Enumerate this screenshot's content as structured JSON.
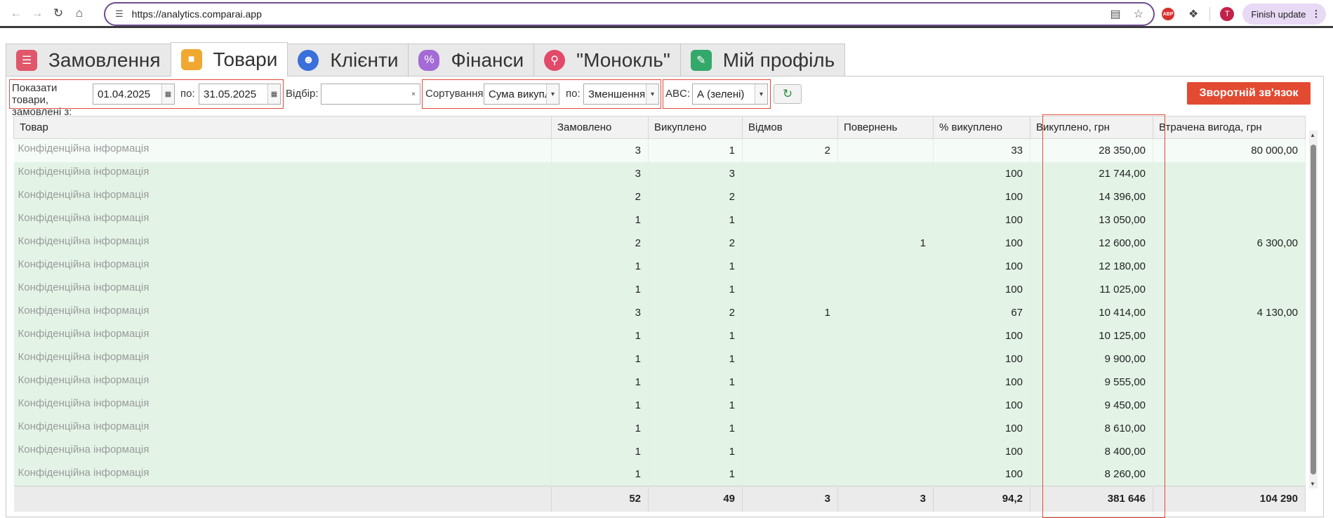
{
  "browser": {
    "url": "https://analytics.comparai.app",
    "finish_update": "Finish update",
    "avatar_letter": "T",
    "abp": "ABP"
  },
  "tabs": [
    {
      "label": "Замовлення",
      "icon": "orders-icon",
      "color": "#e0566a"
    },
    {
      "label": "Товари",
      "icon": "box-icon",
      "color": "#f0a830"
    },
    {
      "label": "Клієнти",
      "icon": "clients-icon",
      "color": "#3b6fd9"
    },
    {
      "label": "Фінанси",
      "icon": "money-bag-icon",
      "color": "#a46ad6"
    },
    {
      "label": "\"Монокль\"",
      "icon": "magnifier-icon",
      "color": "#e24a6a"
    },
    {
      "label": "Мій профіль",
      "icon": "profile-icon",
      "color": "#34a86a"
    }
  ],
  "toolbar": {
    "show_label": "Показати товари, замовлені з:",
    "date_from": "01.04.2025",
    "to_label": "по:",
    "date_to": "31.05.2025",
    "filter_label": "Відбір:",
    "filter_value": "",
    "sort_label": "Сортування:",
    "sort_value": "Сума викупле",
    "sort_dir_label": "по:",
    "sort_dir_value": "Зменшенням",
    "abc_label": "ABC:",
    "abc_value": "А (зелені)",
    "feedback_label": "Зворотній зв'язок"
  },
  "table": {
    "columns": [
      "Товар",
      "Замовлено",
      "Викуплено",
      "Відмов",
      "Повернень",
      "% викуплено",
      "Викуплено, грн",
      "Втрачена вигода, грн"
    ],
    "rows": [
      [
        "Конфіденційна інформація",
        "3",
        "1",
        "2",
        "",
        "33",
        "28 350,00",
        "80 000,00"
      ],
      [
        "Конфіденційна інформація",
        "3",
        "3",
        "",
        "",
        "100",
        "21 744,00",
        ""
      ],
      [
        "Конфіденційна інформація",
        "2",
        "2",
        "",
        "",
        "100",
        "14 396,00",
        ""
      ],
      [
        "Конфіденційна інформація",
        "1",
        "1",
        "",
        "",
        "100",
        "13 050,00",
        ""
      ],
      [
        "Конфіденційна інформація",
        "2",
        "2",
        "",
        "1",
        "100",
        "12 600,00",
        "6 300,00"
      ],
      [
        "Конфіденційна інформація",
        "1",
        "1",
        "",
        "",
        "100",
        "12 180,00",
        ""
      ],
      [
        "Конфіденційна інформація",
        "1",
        "1",
        "",
        "",
        "100",
        "11 025,00",
        ""
      ],
      [
        "Конфіденційна інформація",
        "3",
        "2",
        "1",
        "",
        "67",
        "10 414,00",
        "4 130,00"
      ],
      [
        "Конфіденційна інформація",
        "1",
        "1",
        "",
        "",
        "100",
        "10 125,00",
        ""
      ],
      [
        "Конфіденційна інформація",
        "1",
        "1",
        "",
        "",
        "100",
        "9 900,00",
        ""
      ],
      [
        "Конфіденційна інформація",
        "1",
        "1",
        "",
        "",
        "100",
        "9 555,00",
        ""
      ],
      [
        "Конфіденційна інформація",
        "1",
        "1",
        "",
        "",
        "100",
        "9 450,00",
        ""
      ],
      [
        "Конфіденційна інформація",
        "1",
        "1",
        "",
        "",
        "100",
        "8 610,00",
        ""
      ],
      [
        "Конфіденційна інформація",
        "1",
        "1",
        "",
        "",
        "100",
        "8 400,00",
        ""
      ],
      [
        "Конфіденційна інформація",
        "1",
        "1",
        "",
        "",
        "100",
        "8 260,00",
        ""
      ]
    ],
    "totals": [
      "",
      "52",
      "49",
      "3",
      "3",
      "94,2",
      "381 646",
      "104 290"
    ]
  }
}
